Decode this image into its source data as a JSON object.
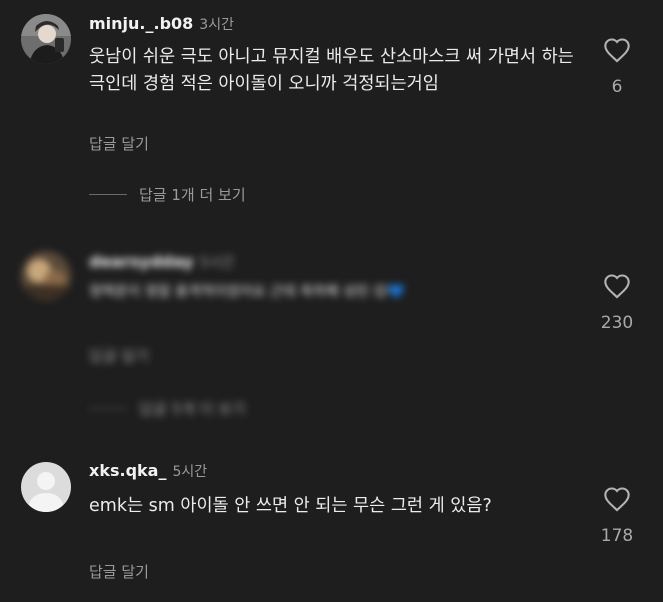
{
  "comments": [
    {
      "username": "minju._.b08",
      "time": "3시간",
      "text": "웃남이 쉬운 극도 아니고 뮤지컬 배우도 산소마스크 써 가면서 하는 극인데 경험 적은 아이돌이 오니까 걱정되는거임",
      "reply": "답글 달기",
      "likes": "6",
      "view_replies": "답글 1개 더 보기",
      "avatar_icon": "profile-photo"
    },
    {
      "username": "dearsydday",
      "time": "5시간",
      "text": "정택운이 정말 충격적이었어요 근데 축하해 성민 ",
      "emoji": "😊💙",
      "reply": "답글 달기",
      "likes": "230",
      "view_replies": "답글 5개 더 보기",
      "avatar_icon": "blurred-profile-photo",
      "blurred": true
    },
    {
      "username": "xks.qka_",
      "time": "5시간",
      "text": "emk는 sm 아이돌 안 쓰면 안 되는 무슨 그런 게 있음?",
      "reply": "답글 달기",
      "likes": "178",
      "avatar_icon": "default-avatar-icon"
    }
  ],
  "colors": {
    "background": "#1e1e1e",
    "text": "#ececec",
    "muted": "#9a9a9a"
  }
}
